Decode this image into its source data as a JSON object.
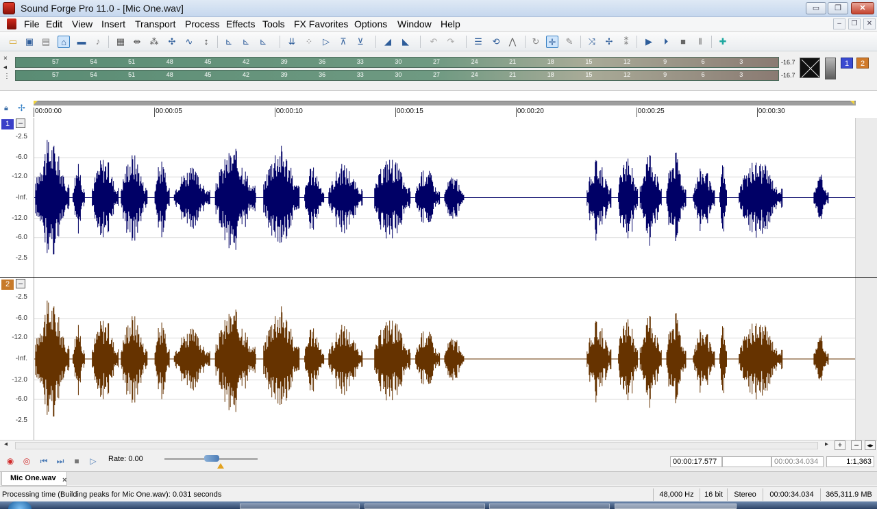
{
  "window": {
    "title": "Sound Forge Pro 11.0 - [Mic One.wav]",
    "minimize_glyph": "▭",
    "maximize_glyph": "❐",
    "close_glyph": "✕"
  },
  "menubar": {
    "items": [
      "File",
      "Edit",
      "View",
      "Insert",
      "Transport",
      "Process",
      "Effects",
      "Tools",
      "FX Favorites",
      "Options",
      "Window",
      "Help"
    ],
    "mdi_min": "–",
    "mdi_restore": "❐",
    "mdi_close": "✕"
  },
  "meters": {
    "ticks": [
      "57",
      "54",
      "51",
      "48",
      "45",
      "42",
      "39",
      "36",
      "33",
      "30",
      "27",
      "24",
      "21",
      "18",
      "15",
      "12",
      "9",
      "6",
      "3"
    ],
    "left_value": "-16.7",
    "right_value": "-16.7",
    "channel_1": "1",
    "channel_2": "2",
    "side_glyphs": [
      "×",
      "◂",
      "⋮"
    ]
  },
  "timeline": {
    "labels": [
      "00:00:00",
      "00:00:05",
      "00:00:10",
      "00:00:15",
      "00:00:20",
      "00:00:25",
      "00:00:30"
    ]
  },
  "channels": [
    {
      "number": "1",
      "color": "#000066",
      "badge_color": "#3a3fc8",
      "db_labels": [
        "-2.5",
        "-6.0",
        "-12.0",
        "-Inf.",
        "-12.0",
        "-6.0",
        "-2.5"
      ]
    },
    {
      "number": "2",
      "color": "#663300",
      "badge_color": "#c77a2a",
      "db_labels": [
        "-2.5",
        "-6.0",
        "-12.0",
        "-Inf.",
        "-12.0",
        "-6.0",
        "-2.5"
      ]
    }
  ],
  "hscroll": {
    "left": "◂",
    "right": "▸",
    "zoom_in": "+",
    "zoom_out": "–",
    "fit": "◂▸"
  },
  "transport": {
    "rate_label": "Rate: 0.00",
    "cursor_time": "00:00:17.577",
    "selection_time": "",
    "length_time": "00:00:34.034",
    "zoom_ratio": "1:1,363"
  },
  "doc_tabs": {
    "active": "Mic One.wav",
    "close_glyph": "×"
  },
  "statusbar": {
    "message": "Processing time (Building peaks for Mic One.wav): 0.031 seconds",
    "sample_rate": "48,000 Hz",
    "bit_depth": "16 bit",
    "channels": "Stereo",
    "length": "00:00:34.034",
    "free_space": "365,311.9 MB"
  },
  "waveform": {
    "duration_s": 34.034,
    "segments": [
      {
        "start": 0.05,
        "end": 1.45,
        "level": 0.78
      },
      {
        "start": 1.6,
        "end": 2.1,
        "level": 0.45
      },
      {
        "start": 2.4,
        "end": 3.5,
        "level": 0.55
      },
      {
        "start": 3.6,
        "end": 4.7,
        "level": 0.6
      },
      {
        "start": 5.0,
        "end": 5.6,
        "level": 0.5
      },
      {
        "start": 5.8,
        "end": 7.3,
        "level": 0.4
      },
      {
        "start": 7.5,
        "end": 9.2,
        "level": 0.65
      },
      {
        "start": 9.5,
        "end": 11.0,
        "level": 0.72
      },
      {
        "start": 11.2,
        "end": 12.0,
        "level": 0.42
      },
      {
        "start": 12.2,
        "end": 13.6,
        "level": 0.45
      },
      {
        "start": 14.1,
        "end": 15.6,
        "level": 0.55
      },
      {
        "start": 15.8,
        "end": 16.8,
        "level": 0.4
      },
      {
        "start": 17.0,
        "end": 17.8,
        "level": 0.3
      },
      {
        "start": 22.9,
        "end": 23.9,
        "level": 0.5
      },
      {
        "start": 24.2,
        "end": 25.0,
        "level": 0.6
      },
      {
        "start": 25.1,
        "end": 26.0,
        "level": 0.65
      },
      {
        "start": 26.2,
        "end": 27.0,
        "level": 0.62
      },
      {
        "start": 27.3,
        "end": 28.2,
        "level": 0.42
      },
      {
        "start": 28.4,
        "end": 28.7,
        "level": 0.48
      },
      {
        "start": 29.2,
        "end": 31.0,
        "level": 0.5
      },
      {
        "start": 32.3,
        "end": 32.9,
        "level": 0.32
      }
    ]
  }
}
